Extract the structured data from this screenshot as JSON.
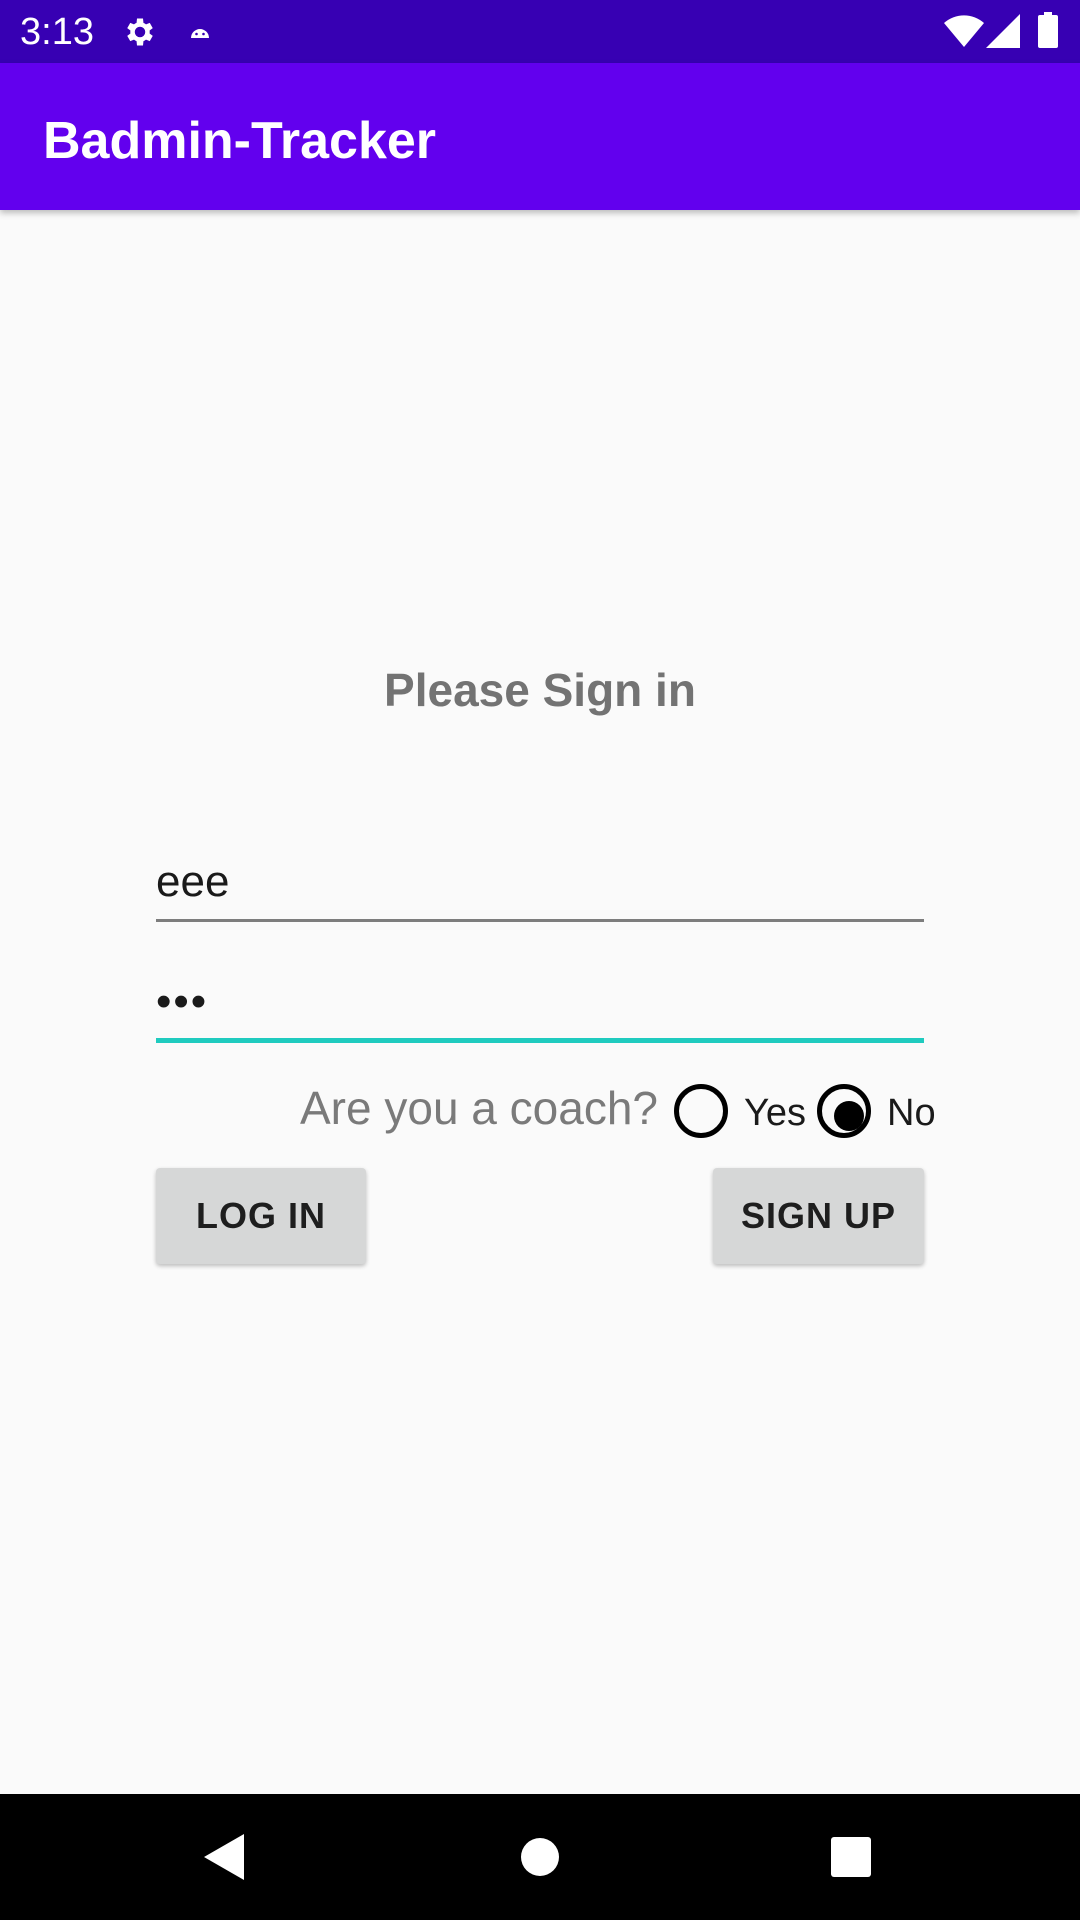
{
  "status_bar": {
    "time": "3:13",
    "icons": [
      "gear-icon",
      "android-icon",
      "wifi-icon",
      "signal-icon",
      "battery-icon"
    ]
  },
  "app_bar": {
    "title": "Badmin-Tracker",
    "background_color": "#6200ee"
  },
  "signin": {
    "heading": "Please Sign in",
    "username_value": "eee",
    "password_value": "•••",
    "coach_question": "Are you a coach?",
    "coach_options": [
      {
        "label": "Yes",
        "selected": false
      },
      {
        "label": "No",
        "selected": true
      }
    ],
    "login_label": "LOG IN",
    "signup_label": "SIGN UP",
    "accent_color": "#1fcbbf"
  },
  "nav_bar": {
    "buttons": [
      "back-icon",
      "home-icon",
      "recents-icon"
    ]
  }
}
